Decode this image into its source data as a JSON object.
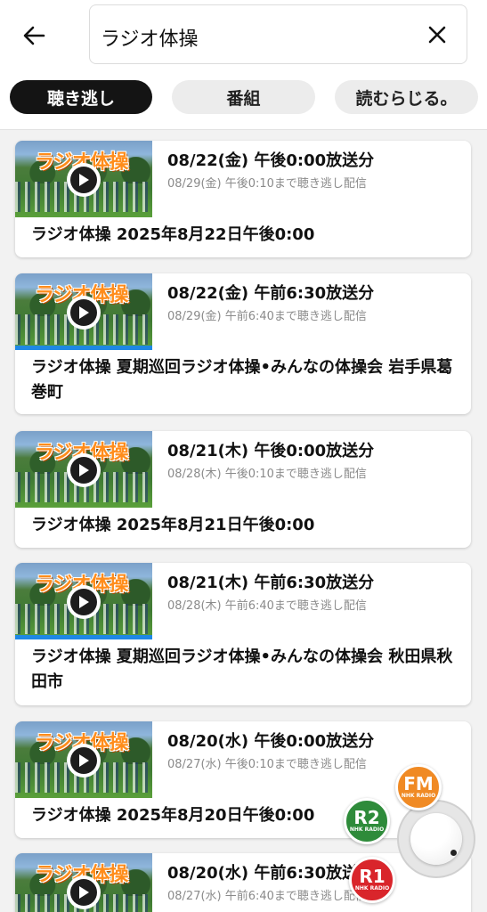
{
  "search": {
    "query": "ラジオ体操"
  },
  "tabs": [
    {
      "label": "聴き逃し"
    },
    {
      "label": "番組"
    },
    {
      "label": "読むらじる。"
    }
  ],
  "thumbnail_logo": "ラジオ体操",
  "episodes": [
    {
      "broadcast": "08/22(金) 午後0:00放送分",
      "deadline": "08/29(金) 午後0:10まで聴き逃し配信",
      "title": "ラジオ体操 2025年8月22日午後0:00",
      "progress": 0
    },
    {
      "broadcast": "08/22(金) 午前6:30放送分",
      "deadline": "08/29(金) 午前6:40まで聴き逃し配信",
      "title": "ラジオ体操 夏期巡回ラジオ体操•みんなの体操会 岩手県葛巻町",
      "progress": 1
    },
    {
      "broadcast": "08/21(木) 午後0:00放送分",
      "deadline": "08/28(木) 午後0:10まで聴き逃し配信",
      "title": "ラジオ体操 2025年8月21日午後0:00",
      "progress": 0
    },
    {
      "broadcast": "08/21(木) 午前6:30放送分",
      "deadline": "08/28(木) 午前6:40まで聴き逃し配信",
      "title": "ラジオ体操 夏期巡回ラジオ体操•みんなの体操会 秋田県秋田市",
      "progress": 1
    },
    {
      "broadcast": "08/20(水) 午後0:00放送分",
      "deadline": "08/27(水) 午後0:10まで聴き逃し配信",
      "title": "ラジオ体操 2025年8月20日午後0:00",
      "progress": 0
    },
    {
      "broadcast": "08/20(水) 午前6:30放送分",
      "deadline": "08/27(水) 午前6:40まで聴き逃し配信",
      "title": "",
      "progress": 0
    }
  ],
  "player": {
    "fm": {
      "label": "FM",
      "sub": "NHK RADIO"
    },
    "r2": {
      "label": "R2",
      "sub": "NHK RADIO"
    },
    "r1": {
      "label": "R1",
      "sub": "NHK RADIO"
    }
  },
  "colors": {
    "accent": "#1e88e5",
    "active_tab_bg": "#141414",
    "fm": "#f08a24",
    "r2": "#2e8b3a",
    "r1": "#d9252b"
  }
}
